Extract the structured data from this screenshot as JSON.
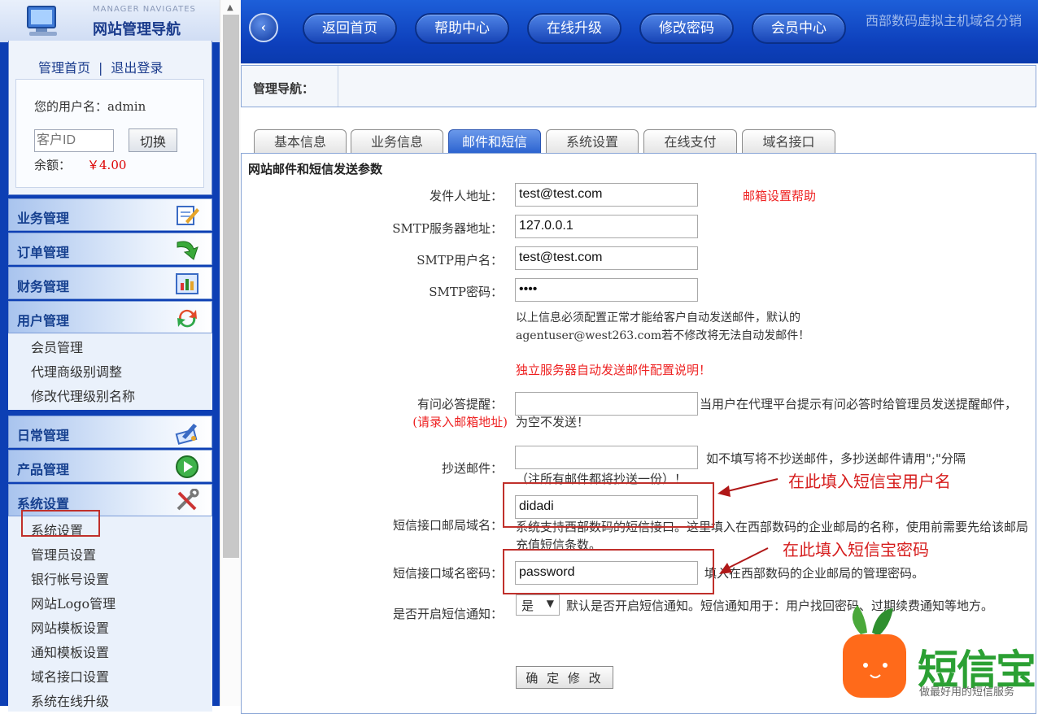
{
  "logo": {
    "en": "MANAGER NAVIGATES",
    "cn": "网站管理导航"
  },
  "user": {
    "home_link": "管理首页",
    "separator": "|",
    "logout_link": "退出登录",
    "username_text": "您的用户名：admin",
    "customer_id_placeholder": "客户ID",
    "switch_label": "切换",
    "balance_label": "余额：",
    "balance_value": "￥4.00"
  },
  "sidebar": {
    "categories": [
      {
        "label": "业务管理",
        "icon": "pencil-form-icon"
      },
      {
        "label": "订单管理",
        "icon": "green-arrow-icon"
      },
      {
        "label": "财务管理",
        "icon": "chart-window-icon"
      },
      {
        "label": "用户管理",
        "icon": "refresh-arrows-icon"
      },
      {
        "label": "日常管理",
        "icon": "pen-tool-icon"
      },
      {
        "label": "产品管理",
        "icon": "play-circle-icon"
      },
      {
        "label": "系统设置",
        "icon": "wrench-tools-icon"
      }
    ],
    "user_sub": [
      "会员管理",
      "代理商级别调整",
      "修改代理级别名称"
    ],
    "system_sub": [
      "系统设置",
      "管理员设置",
      "银行帐号设置",
      "网站Logo管理",
      "网站模板设置",
      "通知模板设置",
      "域名接口设置",
      "系统在线升级"
    ]
  },
  "topnav": {
    "back_symbol": "‹",
    "buttons": [
      "返回首页",
      "帮助中心",
      "在线升级",
      "修改密码",
      "会员中心"
    ],
    "title": "西部数码虚拟主机域名分销"
  },
  "nav_label": "管理导航：",
  "tabs": [
    "基本信息",
    "业务信息",
    "邮件和短信",
    "系统设置",
    "在线支付",
    "域名接口"
  ],
  "active_tab": "邮件和短信",
  "panel": {
    "heading": "网站邮件和短信发送参数",
    "sender_label": "发件人地址：",
    "sender_value": "test@test.com",
    "mail_help": "邮箱设置帮助",
    "smtp_server_label": "SMTP服务器地址：",
    "smtp_server_value": "127.0.0.1",
    "smtp_user_label": "SMTP用户名：",
    "smtp_user_value": "test@test.com",
    "smtp_pass_label": "SMTP密码：",
    "smtp_pass_value": "••••",
    "smtp_note_1": "以上信息必须配置正常才能给客户自动发送邮件，默认的",
    "smtp_note_2": "agentuser@west263.com若不修改将无法自动发邮件！",
    "standalone_note": "独立服务器自动发送邮件配置说明！",
    "qa_label": "有问必答提醒：",
    "qa_hint": "(请录入邮箱地址)",
    "qa_value": "",
    "qa_note": "当用户在代理平台提示有问必答时给管理员发送提醒邮件，为空不发送！",
    "cc_label": "抄送邮件：",
    "cc_value": "",
    "cc_note_1": "如不填写将不抄送邮件，多抄送邮件请用\";\"分隔",
    "cc_note_2": "（注所有邮件都将抄送一份）！",
    "sms_domain_label": "短信接口邮局域名：",
    "sms_domain_value": "didadi",
    "sms_domain_note": "系统支持西部数码的短信接口。这里填入在西部数码的企业邮局的名称，使用前需要先给该邮局充值短信条数。",
    "sms_pass_label": "短信接口域名密码：",
    "sms_pass_value": "password",
    "sms_pass_note": "填入在西部数码的企业邮局的管理密码。",
    "sms_notify_label": "是否开启短信通知：",
    "sms_notify_value": "是",
    "sms_notify_note": "默认是否开启短信通知。短信通知用于：用户找回密码、过期续费通知等地方。",
    "submit_label": "确 定 修 改"
  },
  "annotations": {
    "username_hint": "在此填入短信宝用户名",
    "password_hint": "在此填入短信宝密码"
  },
  "watermark": {
    "brand": "短信宝",
    "slogan": "做最好用的短信服务"
  }
}
